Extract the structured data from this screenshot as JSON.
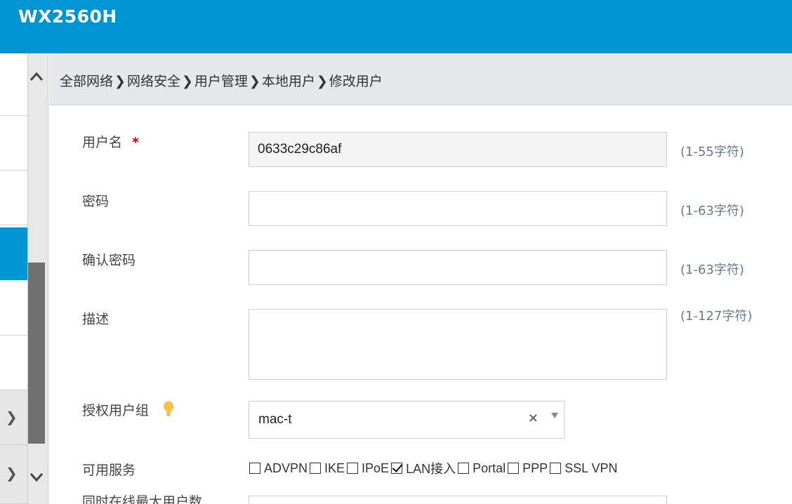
{
  "app": {
    "title": "WX2560H"
  },
  "breadcrumb": [
    "全部网络",
    "网络安全",
    "用户管理",
    "本地用户",
    "修改用户"
  ],
  "breadcrumb_sep": "❯",
  "form": {
    "username": {
      "label": "用户名",
      "required_mark": "*",
      "value": "0633c29c86af",
      "hint": "(1-55字符)"
    },
    "password": {
      "label": "密码",
      "value": "",
      "hint": "(1-63字符)"
    },
    "confirm_password": {
      "label": "确认密码",
      "value": "",
      "hint": "(1-63字符)"
    },
    "description": {
      "label": "描述",
      "value": "",
      "hint": "(1-127字符)"
    },
    "auth_group": {
      "label": "授权用户组",
      "value": "mac-t",
      "clear": "×"
    },
    "services": {
      "label": "可用服务",
      "items": [
        {
          "label": "ADVPN",
          "checked": false
        },
        {
          "label": "IKE",
          "checked": false
        },
        {
          "label": "IPoE",
          "checked": false
        },
        {
          "label": "LAN接入",
          "checked": true
        },
        {
          "label": "Portal",
          "checked": false
        },
        {
          "label": "PPP",
          "checked": false
        },
        {
          "label": "SSL VPN",
          "checked": false
        }
      ]
    },
    "next_label_partial": "同时在线最大用户数"
  },
  "sidebar": {
    "expand_icon": "chevron-right-icon",
    "scroll_up_icon": "chevron-up-icon",
    "scroll_down_icon": "chevron-down-icon"
  },
  "colors": {
    "brand": "#0096d6",
    "required": "#d0021b",
    "hint": "#6a7a8a",
    "bulb": "#f5c242"
  }
}
